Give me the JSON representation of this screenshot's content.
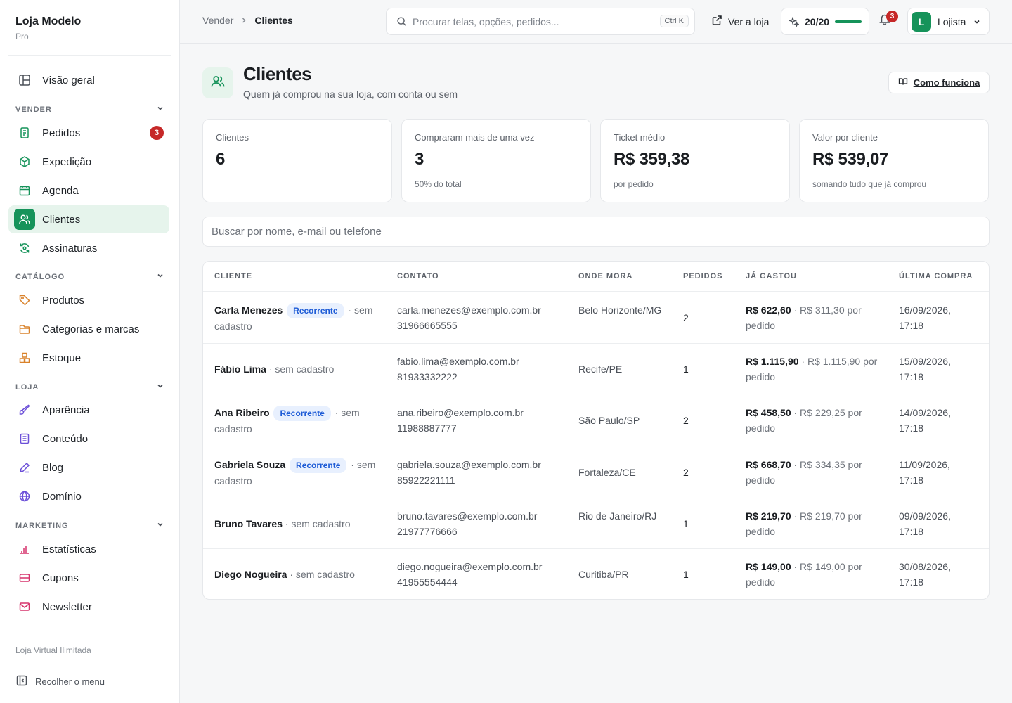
{
  "brand": {
    "name": "Loja Modelo",
    "plan": "Pro"
  },
  "sidebar": {
    "overview": "Visão geral",
    "sections": [
      {
        "title": "VENDER",
        "items": [
          {
            "label": "Pedidos",
            "badge": "3"
          },
          {
            "label": "Expedição"
          },
          {
            "label": "Agenda"
          },
          {
            "label": "Clientes",
            "active": true
          },
          {
            "label": "Assinaturas"
          }
        ]
      },
      {
        "title": "CATÁLOGO",
        "items": [
          {
            "label": "Produtos"
          },
          {
            "label": "Categorias e marcas"
          },
          {
            "label": "Estoque"
          }
        ]
      },
      {
        "title": "LOJA",
        "items": [
          {
            "label": "Aparência"
          },
          {
            "label": "Conteúdo"
          },
          {
            "label": "Blog"
          },
          {
            "label": "Domínio"
          }
        ]
      },
      {
        "title": "MARKETING",
        "items": [
          {
            "label": "Estatísticas"
          },
          {
            "label": "Cupons"
          },
          {
            "label": "Newsletter"
          }
        ]
      }
    ],
    "footer_text": "Loja Virtual Ilimitada",
    "collapse_label": "Recolher o menu"
  },
  "topbar": {
    "breadcrumb": [
      "Vender",
      "Clientes"
    ],
    "search_placeholder": "Procurar telas, opções, pedidos...",
    "shortcut": "Ctrl K",
    "view_store": "Ver a loja",
    "quota": "20/20",
    "notifications": "3",
    "user_initial": "L",
    "user_name": "Lojista"
  },
  "header": {
    "title": "Clientes",
    "subtitle": "Quem já comprou na sua loja, com conta ou sem",
    "howto": "Como funciona"
  },
  "stats": [
    {
      "label": "Clientes",
      "value": "6",
      "note": ""
    },
    {
      "label": "Compraram mais de uma vez",
      "value": "3",
      "note": "50% do total"
    },
    {
      "label": "Ticket médio",
      "value": "R$ 359,38",
      "note": "por pedido"
    },
    {
      "label": "Valor por cliente",
      "value": "R$ 539,07",
      "note": "somando tudo que já comprou"
    }
  ],
  "filter": {
    "placeholder": "Buscar por nome, e-mail ou telefone"
  },
  "table": {
    "headers": [
      "CLIENTE",
      "CONTATO",
      "ONDE MORA",
      "PEDIDOS",
      "JÁ GASTOU",
      "ÚLTIMA COMPRA"
    ],
    "rows": [
      {
        "name": "Carla Menezes",
        "tag": "Recorrente",
        "status": "· sem cadastro",
        "email": "carla.menezes@exemplo.com.br",
        "phone": "31966665555",
        "place": "Belo Horizonte/MG",
        "orders": "2",
        "spent": "R$ 622,60",
        "per_order": "· R$ 311,30 por pedido",
        "date": "16/09/2026,",
        "time": "17:18"
      },
      {
        "name": "Fábio Lima",
        "tag": "",
        "status": "· sem cadastro",
        "email": "fabio.lima@exemplo.com.br",
        "phone": "81933332222",
        "place": "Recife/PE",
        "orders": "1",
        "spent": "R$ 1.115,90",
        "per_order": "· R$ 1.115,90 por pedido",
        "date": "15/09/2026,",
        "time": "17:18"
      },
      {
        "name": "Ana Ribeiro",
        "tag": "Recorrente",
        "status": "· sem cadastro",
        "email": "ana.ribeiro@exemplo.com.br",
        "phone": "11988887777",
        "place": "São Paulo/SP",
        "orders": "2",
        "spent": "R$ 458,50",
        "per_order": "· R$ 229,25 por pedido",
        "date": "14/09/2026,",
        "time": "17:18"
      },
      {
        "name": "Gabriela Souza",
        "tag": "Recorrente",
        "status": "· sem cadastro",
        "email": "gabriela.souza@exemplo.com.br",
        "phone": "85922221111",
        "place": "Fortaleza/CE",
        "orders": "2",
        "spent": "R$ 668,70",
        "per_order": "· R$ 334,35 por pedido",
        "date": "11/09/2026,",
        "time": "17:18"
      },
      {
        "name": "Bruno Tavares",
        "tag": "",
        "status": "· sem cadastro",
        "email": "bruno.tavares@exemplo.com.br",
        "phone": "21977776666",
        "place": "Rio de Janeiro/RJ",
        "orders": "1",
        "spent": "R$ 219,70",
        "per_order": "· R$ 219,70 por pedido",
        "date": "09/09/2026,",
        "time": "17:18"
      },
      {
        "name": "Diego Nogueira",
        "tag": "",
        "status": "· sem cadastro",
        "email": "diego.nogueira@exemplo.com.br",
        "phone": "41955554444",
        "place": "Curitiba/PR",
        "orders": "1",
        "spent": "R$ 149,00",
        "per_order": "· R$ 149,00 por pedido",
        "date": "30/08/2026,",
        "time": "17:18"
      }
    ]
  },
  "colors": {
    "accent": "#16935a",
    "accent_bg": "#e6f4ec",
    "badge": "#c62828",
    "tag_bg": "#e8f0fe",
    "tag_text": "#1d5bd6"
  }
}
